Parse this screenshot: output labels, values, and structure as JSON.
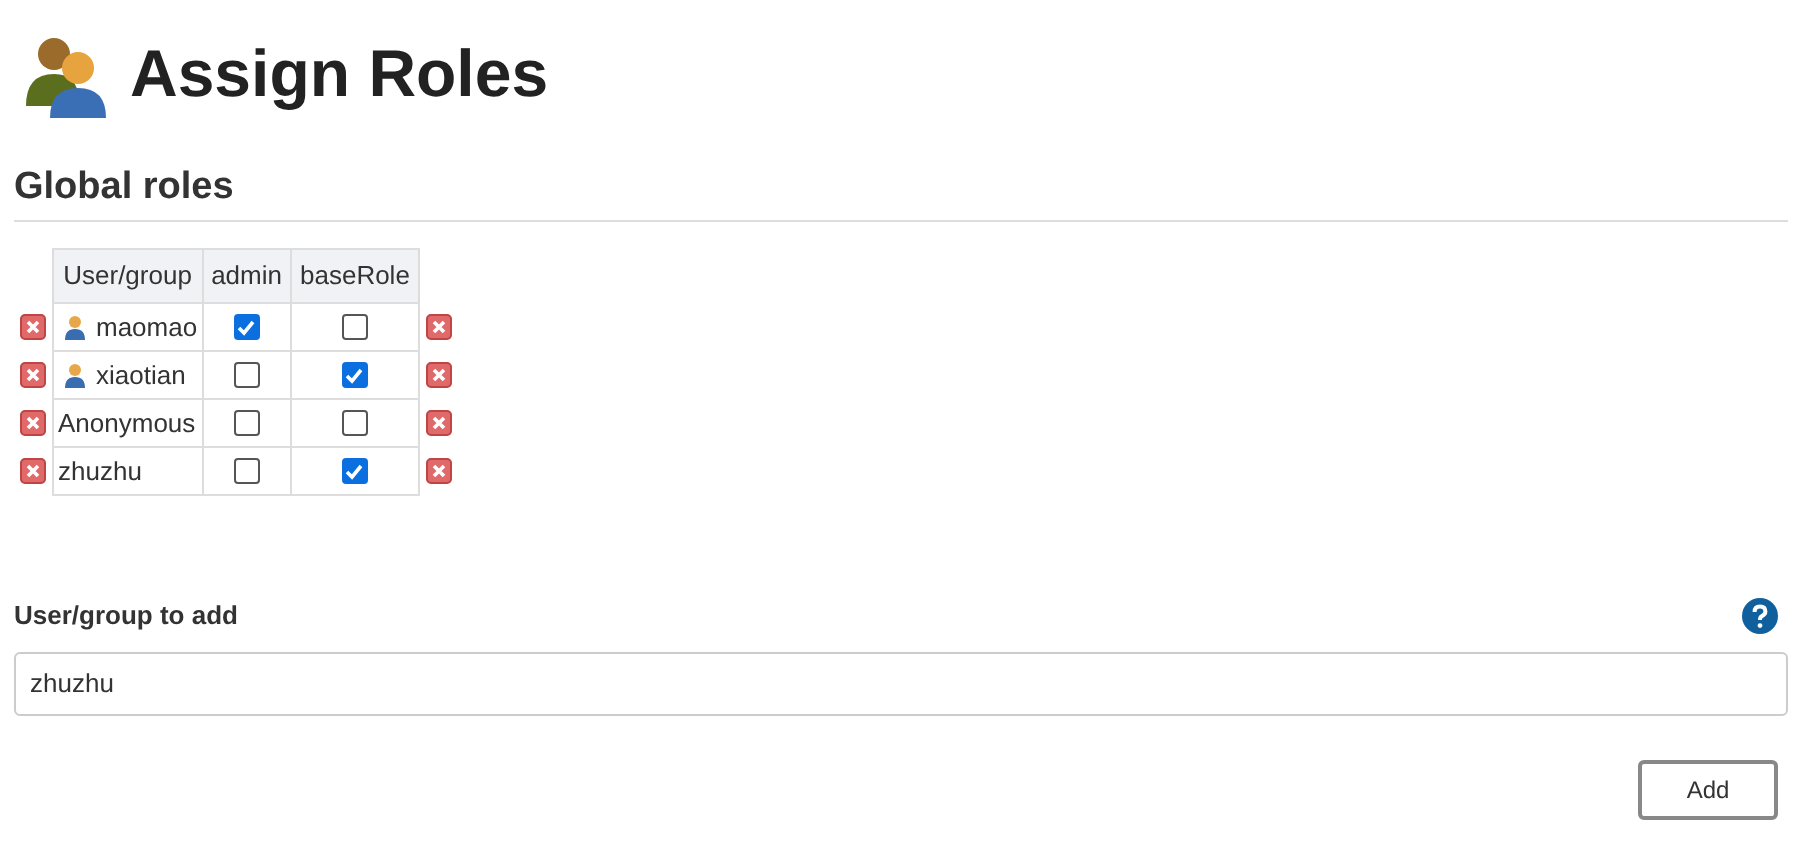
{
  "page": {
    "title": "Assign Roles"
  },
  "global_roles": {
    "heading": "Global roles",
    "columns": [
      "User/group",
      "admin",
      "baseRole"
    ],
    "rows": [
      {
        "name": "maomao",
        "kind": "user",
        "roles": [
          true,
          false
        ]
      },
      {
        "name": "xiaotian",
        "kind": "user",
        "roles": [
          false,
          true
        ]
      },
      {
        "name": "Anonymous",
        "kind": "plain",
        "roles": [
          false,
          false
        ]
      },
      {
        "name": "zhuzhu",
        "kind": "plain",
        "roles": [
          false,
          true
        ]
      }
    ]
  },
  "add_form": {
    "label": "User/group to add",
    "value": "zhuzhu",
    "button": "Add"
  }
}
